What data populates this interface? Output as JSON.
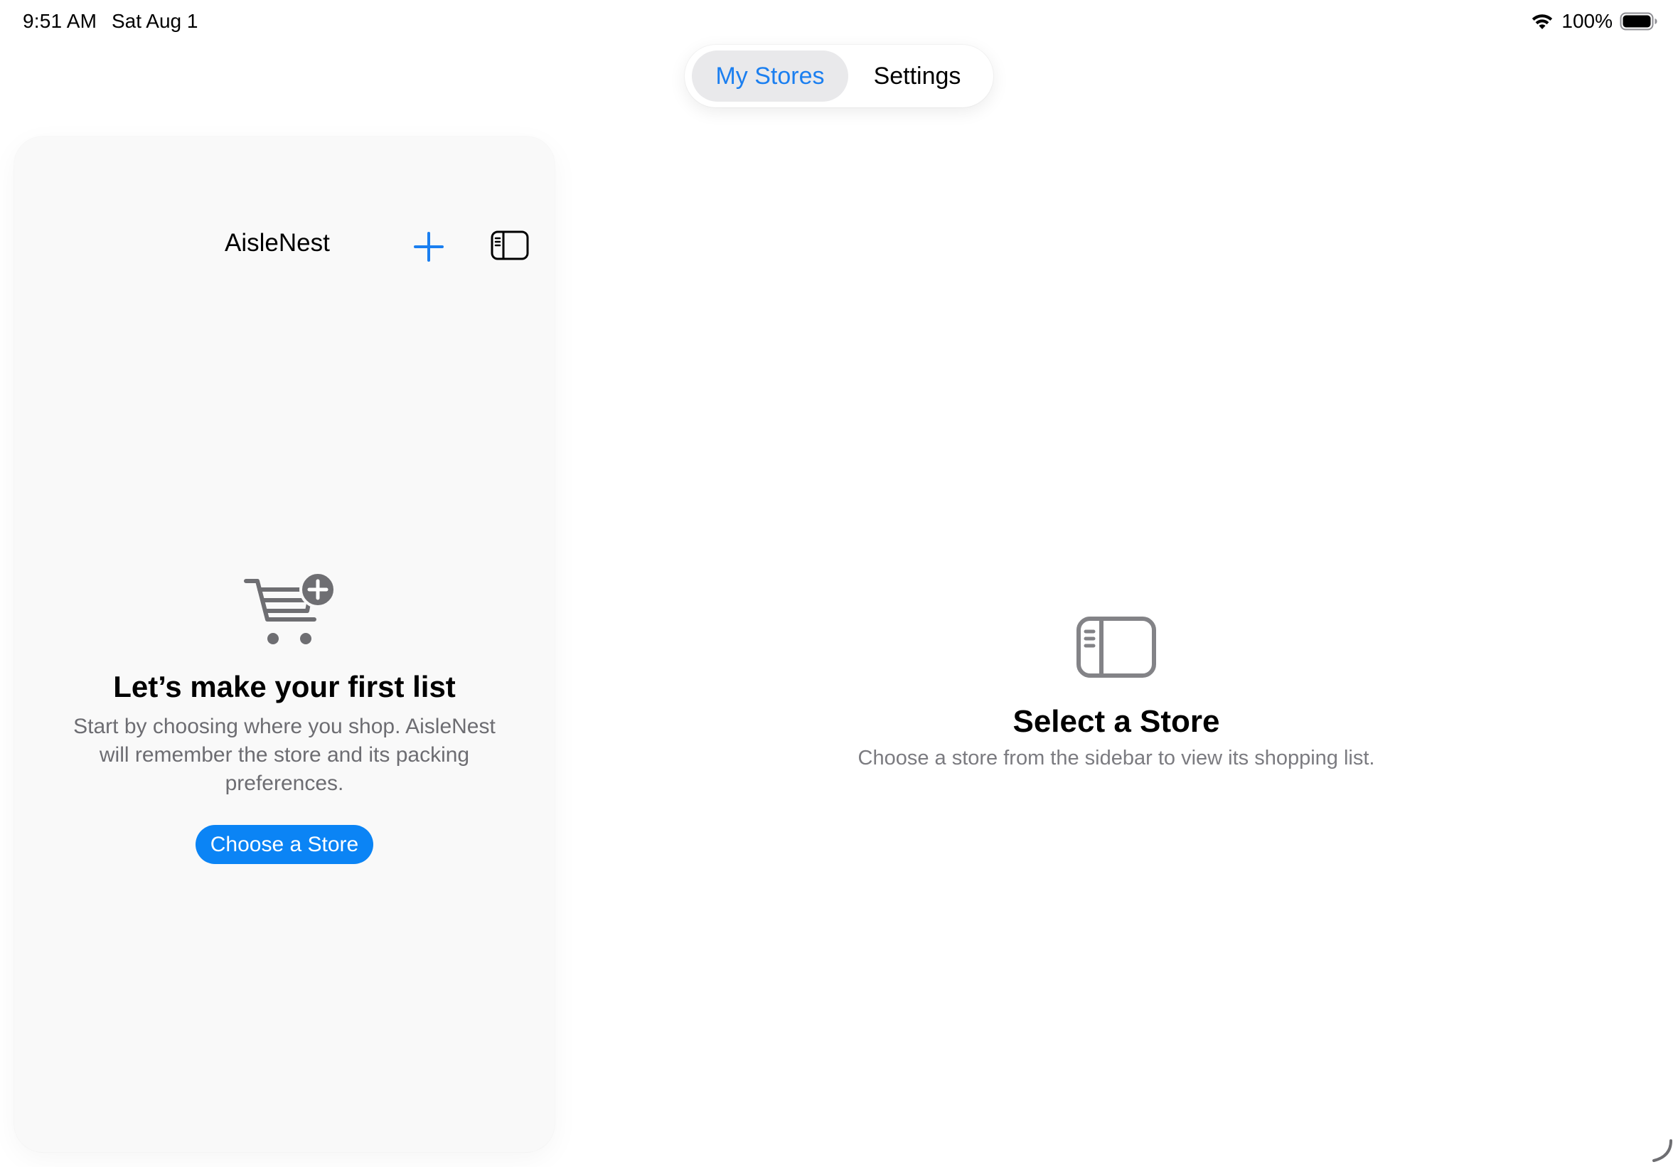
{
  "status_bar": {
    "time": "9:51 AM",
    "date": "Sat Aug 1",
    "battery": "100%",
    "icons": [
      "wifi-icon",
      "battery-icon"
    ]
  },
  "tabs": [
    {
      "label": "My Stores",
      "active": true
    },
    {
      "label": "Settings",
      "active": false
    }
  ],
  "sidebar": {
    "title": "AisleNest",
    "add_icon": "plus-icon",
    "toggle_icon": "sidebar-icon",
    "empty_state": {
      "icon": "cart-plus-icon",
      "heading": "Let’s make your first list",
      "description": "Start by choosing where you shop. AisleNest will remember the store and its packing preferences.",
      "button_label": "Choose a Store"
    }
  },
  "detail": {
    "icon": "sidebar-icon",
    "heading": "Select a Store",
    "description": "Choose a store from the sidebar to view its shopping list."
  },
  "colors": {
    "accent": "#0b84f5",
    "tab_active_text": "#1b7ff0",
    "secondary_text": "#6d6d72",
    "icon_gray": "#838387"
  }
}
